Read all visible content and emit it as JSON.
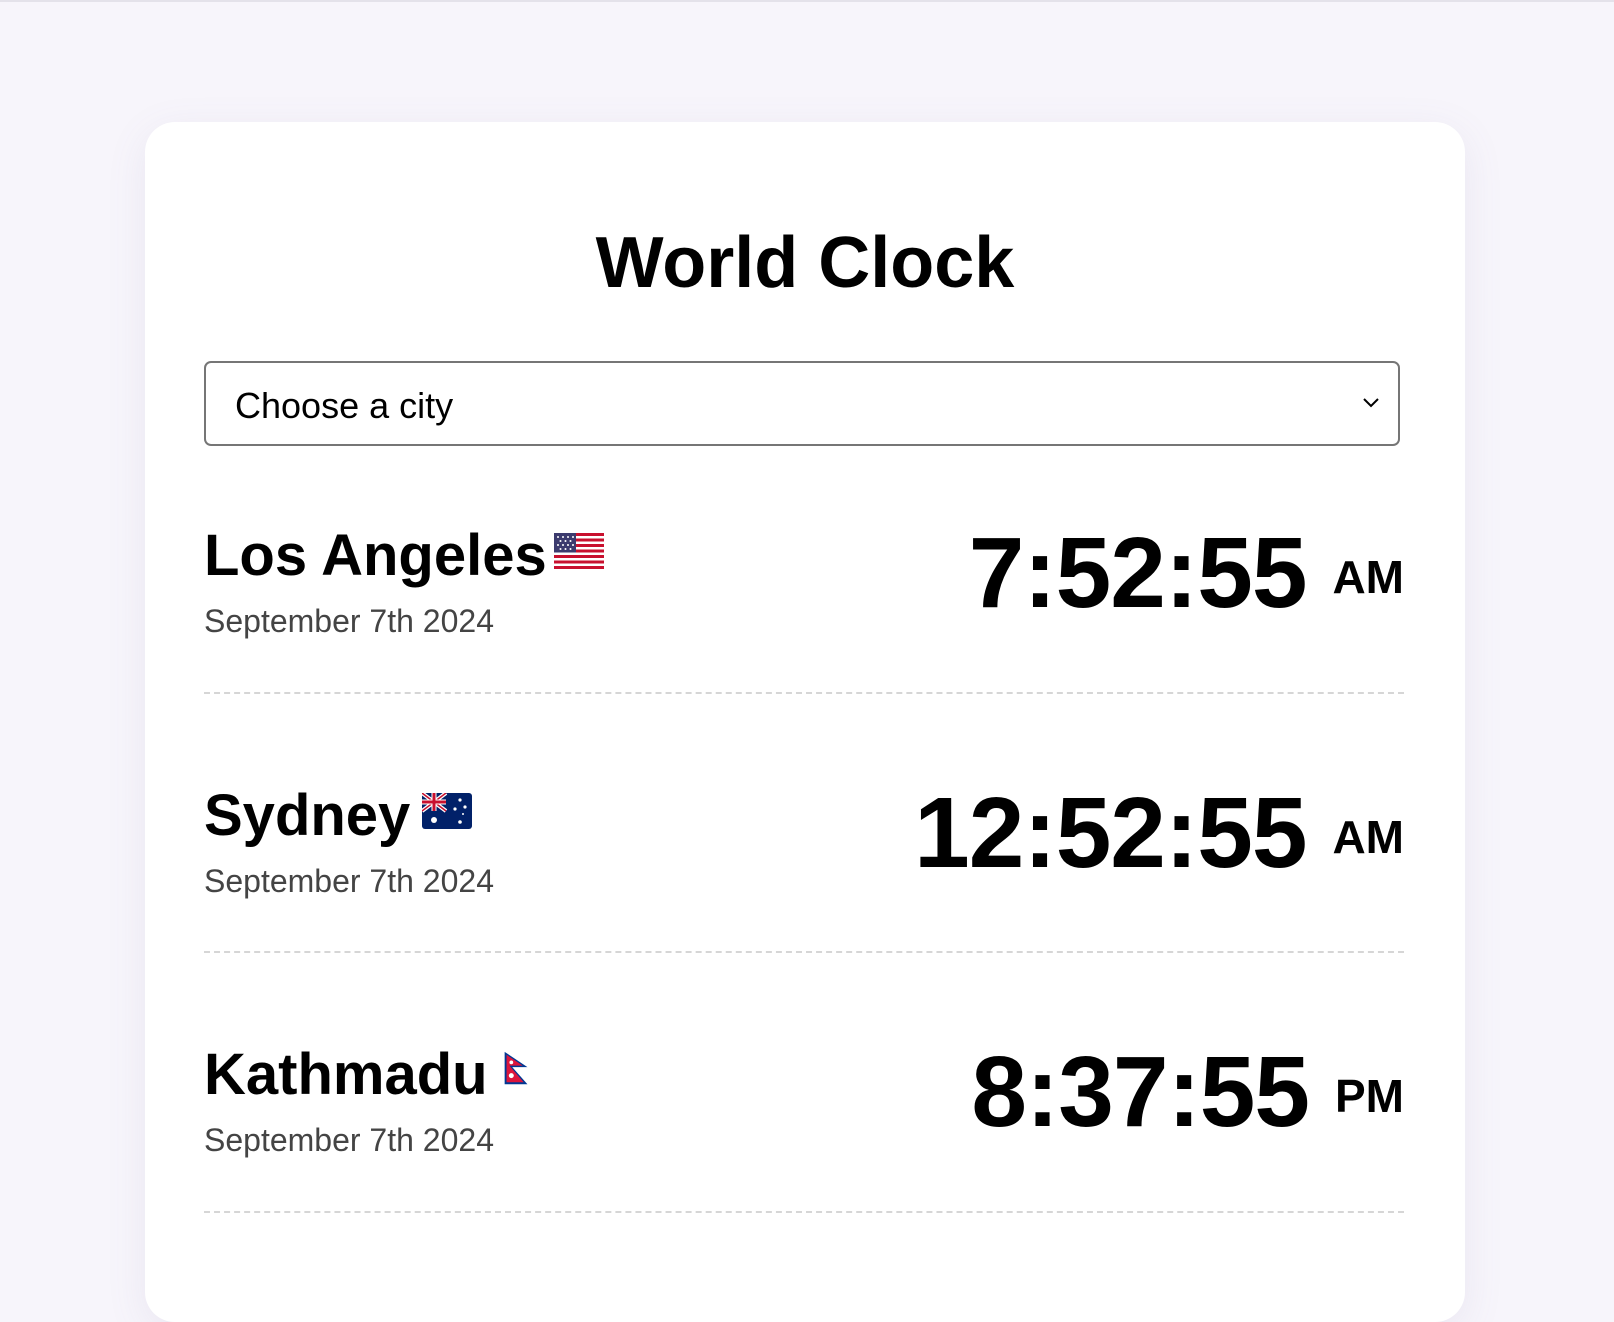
{
  "title": "World Clock",
  "city_select": {
    "placeholder": "Choose a city"
  },
  "cities": [
    {
      "name": "Los Angeles",
      "flag_icon": "us-flag-icon",
      "date": "September 7th 2024",
      "time": "7:52:55",
      "period": "AM"
    },
    {
      "name": "Sydney",
      "flag_icon": "australia-flag-icon",
      "date": "September 7th 2024",
      "time": "12:52:55",
      "period": "AM"
    },
    {
      "name": "Kathmadu",
      "flag_icon": "nepal-flag-icon",
      "date": "September 7th 2024",
      "time": "8:37:55",
      "period": "PM"
    }
  ],
  "colors": {
    "background": "#f7f5fb",
    "card": "#ffffff",
    "text": "#000000",
    "date_text": "#444444",
    "divider": "#d6d6d6"
  }
}
